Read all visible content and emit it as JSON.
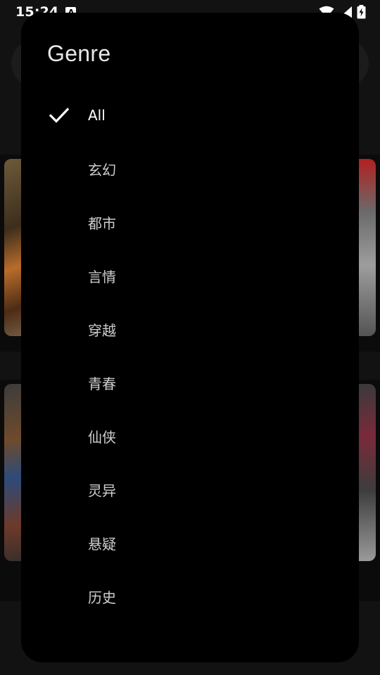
{
  "status_bar": {
    "time": "15:24",
    "notification_badge": "A",
    "icons": [
      "wifi-icon",
      "signal-icon",
      "battery-charging-icon"
    ]
  },
  "genre_dialog": {
    "title": "Genre",
    "selected": "All",
    "options": [
      {
        "label": "All",
        "selected": true
      },
      {
        "label": "玄幻",
        "selected": false
      },
      {
        "label": "都市",
        "selected": false
      },
      {
        "label": "言情",
        "selected": false
      },
      {
        "label": "穿越",
        "selected": false
      },
      {
        "label": "青春",
        "selected": false
      },
      {
        "label": "仙侠",
        "selected": false
      },
      {
        "label": "灵异",
        "selected": false
      },
      {
        "label": "悬疑",
        "selected": false
      },
      {
        "label": "历史",
        "selected": false
      }
    ]
  },
  "colors": {
    "sheet_background": "#000000",
    "page_background": "#121212",
    "text_primary": "#ffffff",
    "text_secondary": "#cfcfcf"
  }
}
